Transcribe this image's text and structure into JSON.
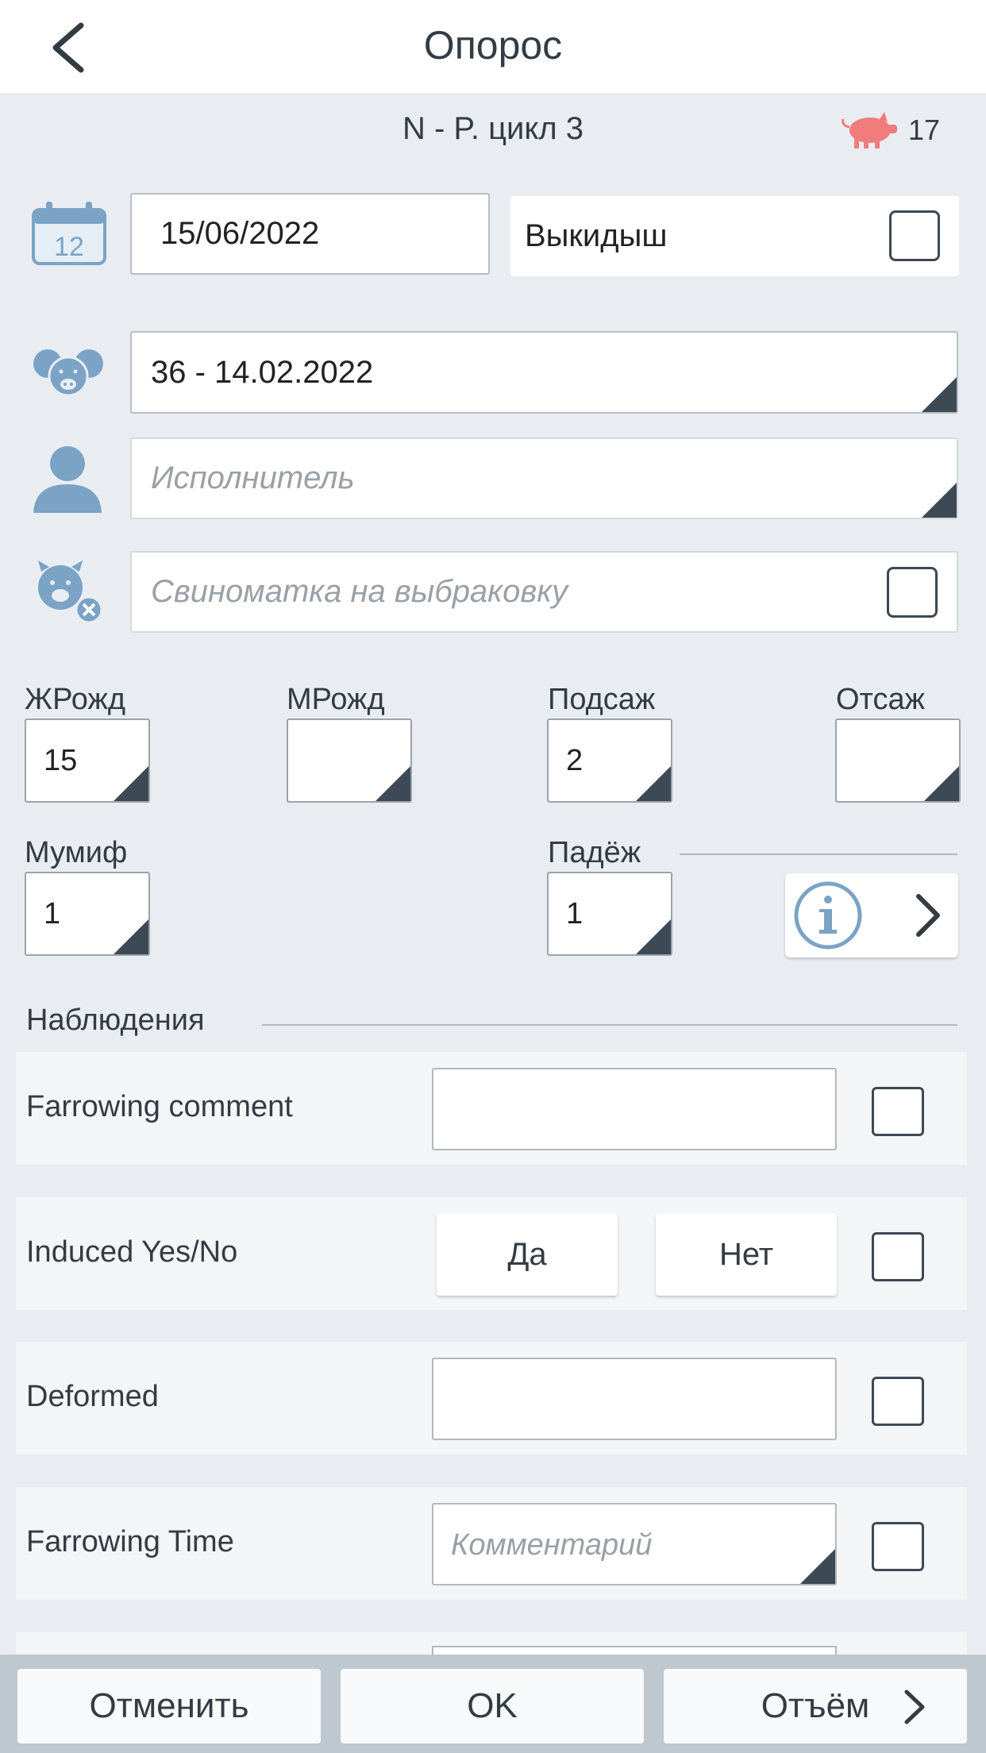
{
  "header": {
    "title": "Опорос"
  },
  "subheader": {
    "text": "N - P. цикл 3",
    "pig_count": "17"
  },
  "date_field": {
    "value": "15/06/2022"
  },
  "abortion": {
    "label": "Выкидыш",
    "checked": false
  },
  "mating_field": {
    "value": "36 - 14.02.2022"
  },
  "performer_field": {
    "placeholder": "Исполнитель"
  },
  "cull_field": {
    "placeholder": "Свиноматка на выбраковку",
    "checked": false
  },
  "counts": {
    "live_born": {
      "label": "ЖРожд",
      "value": "15"
    },
    "still_born": {
      "label": "МРожд",
      "value": ""
    },
    "fostered_in": {
      "label": "Подсаж",
      "value": "2"
    },
    "fostered_out": {
      "label": "Отсаж",
      "value": ""
    },
    "mummified": {
      "label": "Мумиф",
      "value": "1"
    },
    "dead": {
      "label": "Падёж",
      "value": "1"
    }
  },
  "observations": {
    "title": "Наблюдения",
    "rows": [
      {
        "label": "Farrowing comment",
        "type": "text",
        "value": ""
      },
      {
        "label": "Induced Yes/No",
        "type": "yesno",
        "yes": "Да",
        "no": "Нет"
      },
      {
        "label": "Deformed",
        "type": "text",
        "value": ""
      },
      {
        "label": "Farrowing Time",
        "type": "dropdown",
        "placeholder": "Комментарий"
      }
    ]
  },
  "footer": {
    "cancel": "Отменить",
    "ok": "OK",
    "weaning": "Отъём"
  },
  "colors": {
    "accent": "#3d4954",
    "icon_blue": "#7aa3c6",
    "pig_pink": "#f07c7c"
  }
}
